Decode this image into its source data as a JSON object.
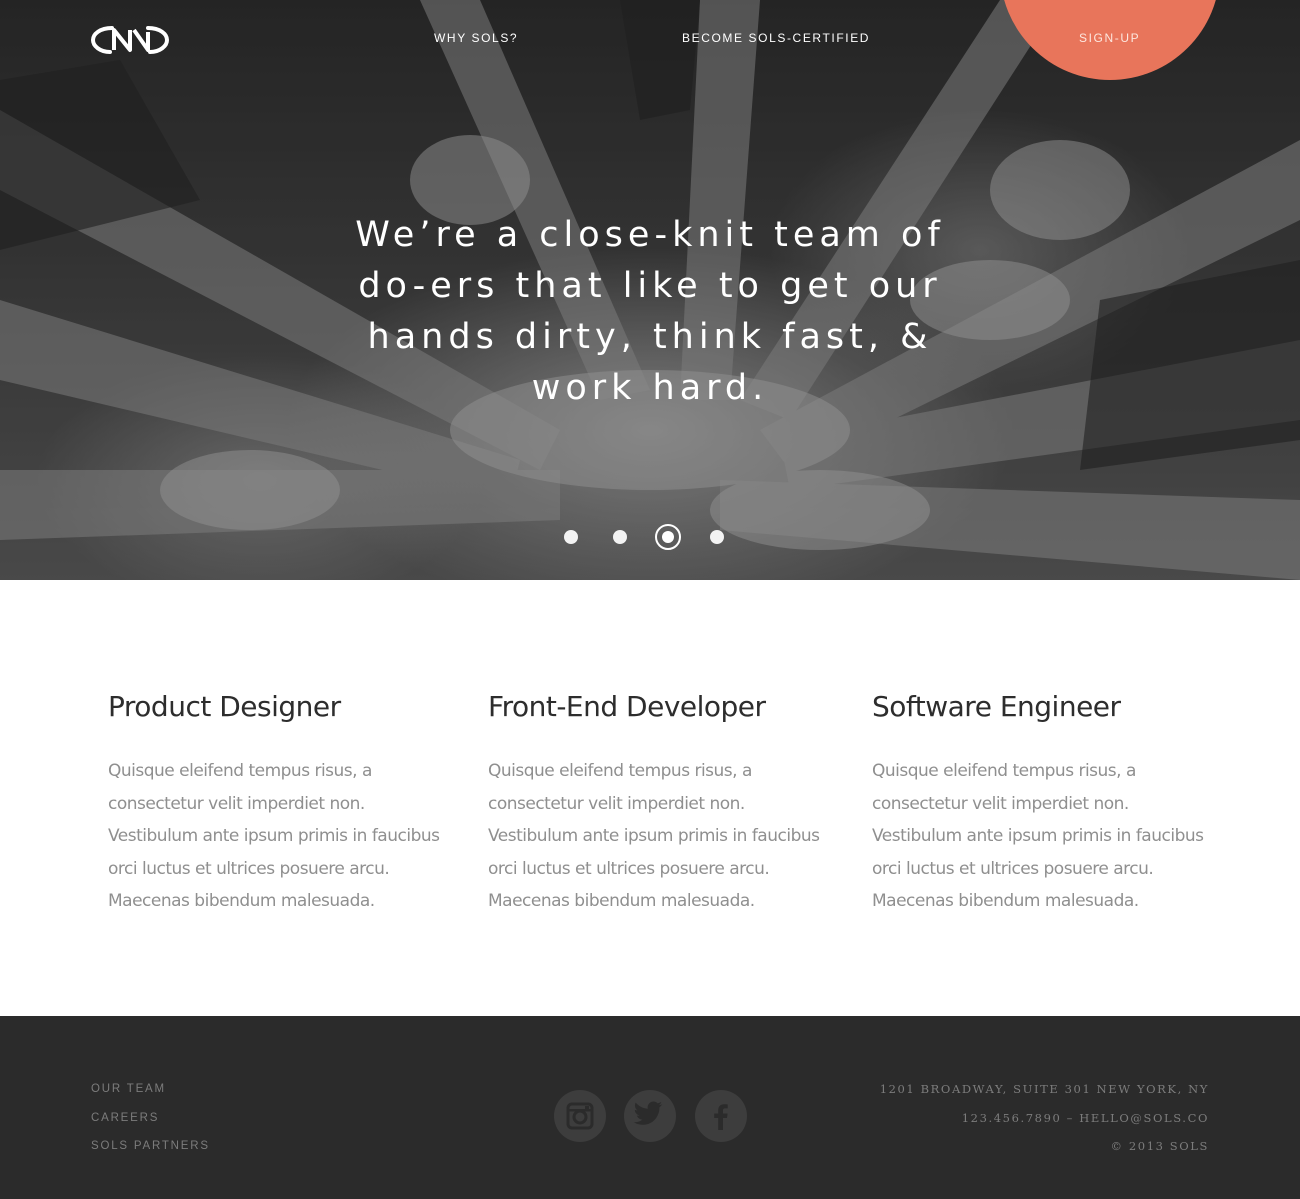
{
  "nav": {
    "why": "WHY SOLS?",
    "certified": "BECOME SOLS-CERTIFIED",
    "signup": "SIGN-UP"
  },
  "hero": {
    "tagline": "We’re a close-knit team of do-ers that like to get our hands dirty, think fast, & work hard.",
    "slides_total": 4,
    "active_slide": 3
  },
  "jobs": [
    {
      "title": "Product Designer",
      "description": "Quisque eleifend tempus risus, a consectetur velit imperdiet non. Vestibulum ante ipsum primis in faucibus orci luctus et ultrices posuere arcu. Maecenas bibendum malesuada."
    },
    {
      "title": "Front-End Developer",
      "description": "Quisque eleifend tempus risus, a consectetur velit imperdiet non. Vestibulum ante ipsum primis in faucibus orci luctus et ultrices posuere arcu. Maecenas bibendum malesuada."
    },
    {
      "title": "Software Engineer",
      "description": "Quisque eleifend tempus risus, a consectetur velit imperdiet non. Vestibulum ante ipsum primis in faucibus orci luctus et ultrices posuere arcu. Maecenas bibendum malesuada."
    }
  ],
  "footer": {
    "links": [
      "OUR TEAM",
      "CAREERS",
      "SOLS PARTNERS"
    ],
    "social": [
      "instagram-icon",
      "twitter-icon",
      "facebook-icon"
    ],
    "address": "1201 BROADWAY, SUITE 301 NEW YORK, NY",
    "contact": "123.456.7890 – HELLO@SOLS.CO",
    "copyright": "© 2013 SOLS"
  },
  "colors": {
    "accent": "#e8755b",
    "footer_bg": "#2b2b2b",
    "body_text": "#8f8f8f"
  }
}
